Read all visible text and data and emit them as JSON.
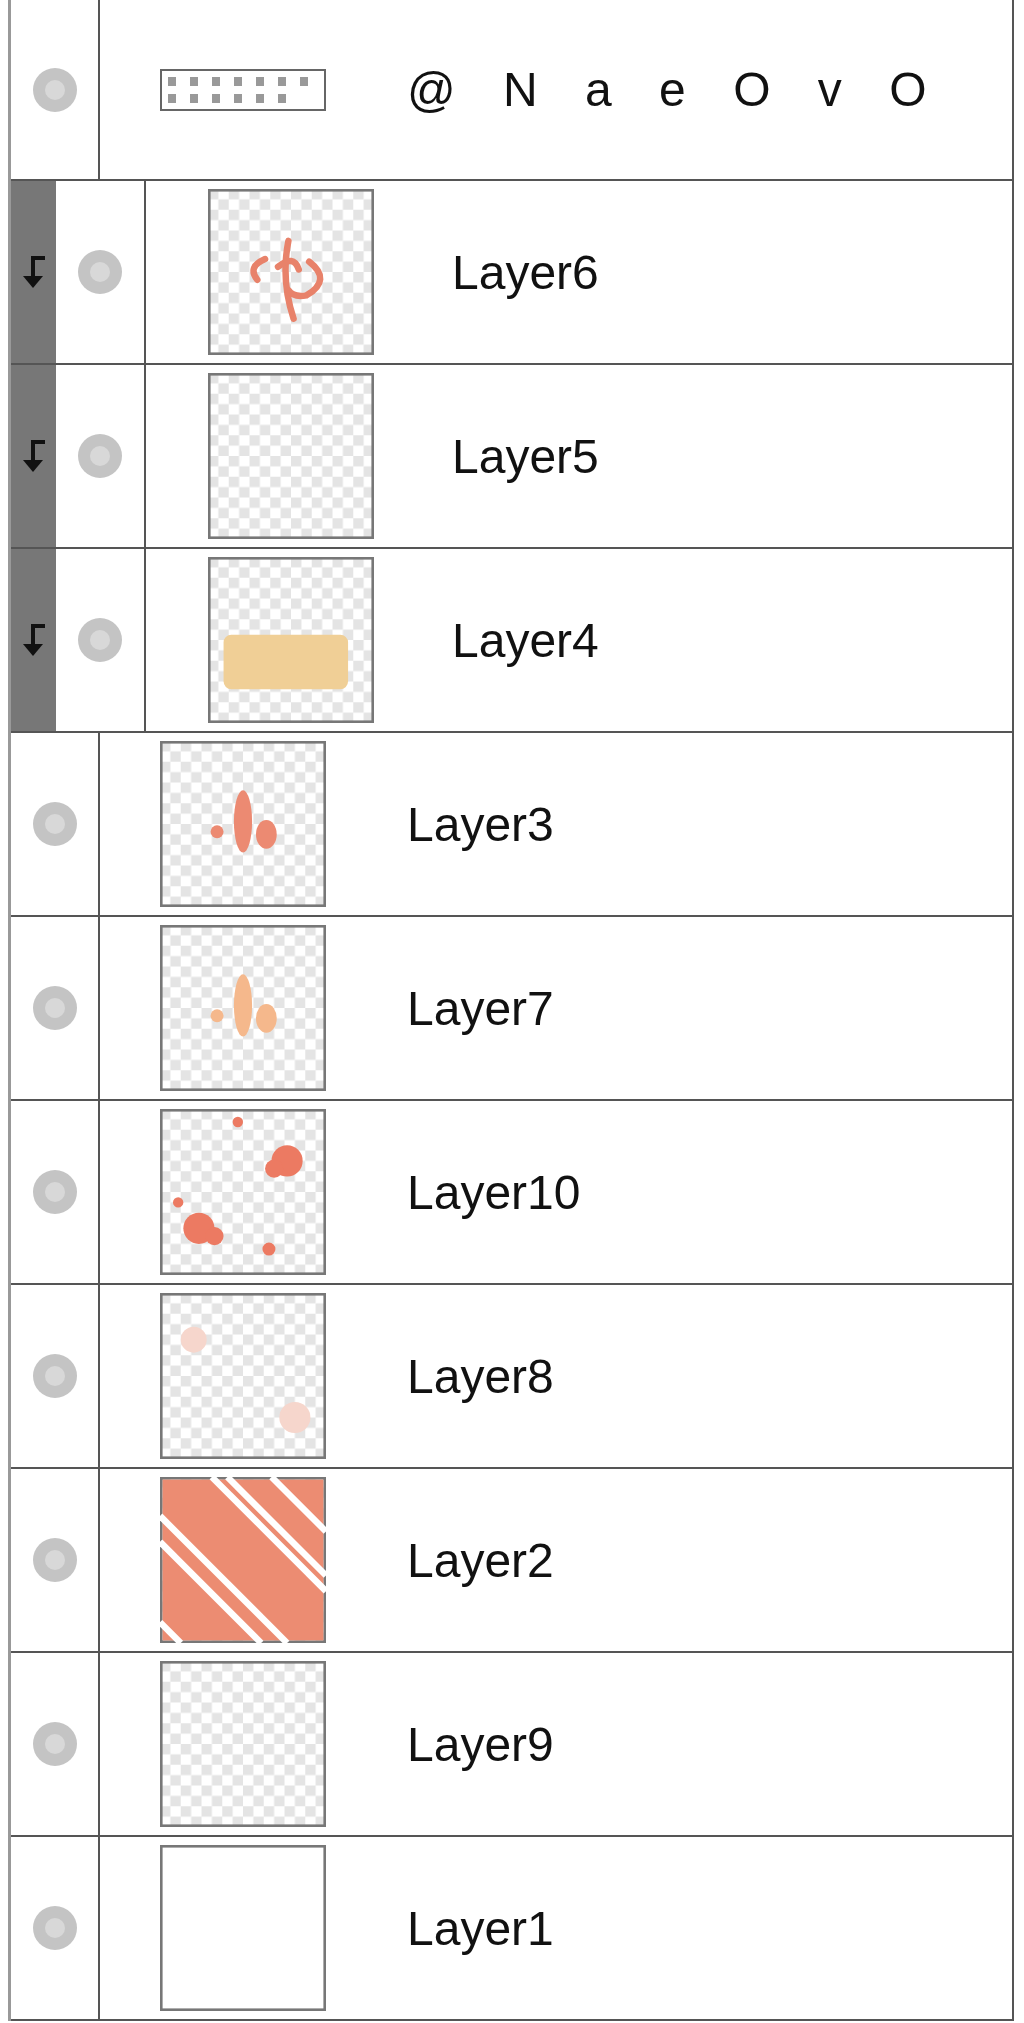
{
  "layers": [
    {
      "kind": "text",
      "name": "@ N a e O v O",
      "clipped": false
    },
    {
      "kind": "raster",
      "name": "Layer6",
      "clipped": true
    },
    {
      "kind": "raster",
      "name": "Layer5",
      "clipped": true
    },
    {
      "kind": "raster",
      "name": "Layer4",
      "clipped": true
    },
    {
      "kind": "raster",
      "name": "Layer3",
      "clipped": false
    },
    {
      "kind": "raster",
      "name": "Layer7",
      "clipped": false
    },
    {
      "kind": "raster",
      "name": "Layer10",
      "clipped": false
    },
    {
      "kind": "raster",
      "name": "Layer8",
      "clipped": false
    },
    {
      "kind": "raster",
      "name": "Layer2",
      "clipped": false
    },
    {
      "kind": "raster",
      "name": "Layer9",
      "clipped": false
    },
    {
      "kind": "raster",
      "name": "Layer1",
      "clipped": false
    }
  ]
}
